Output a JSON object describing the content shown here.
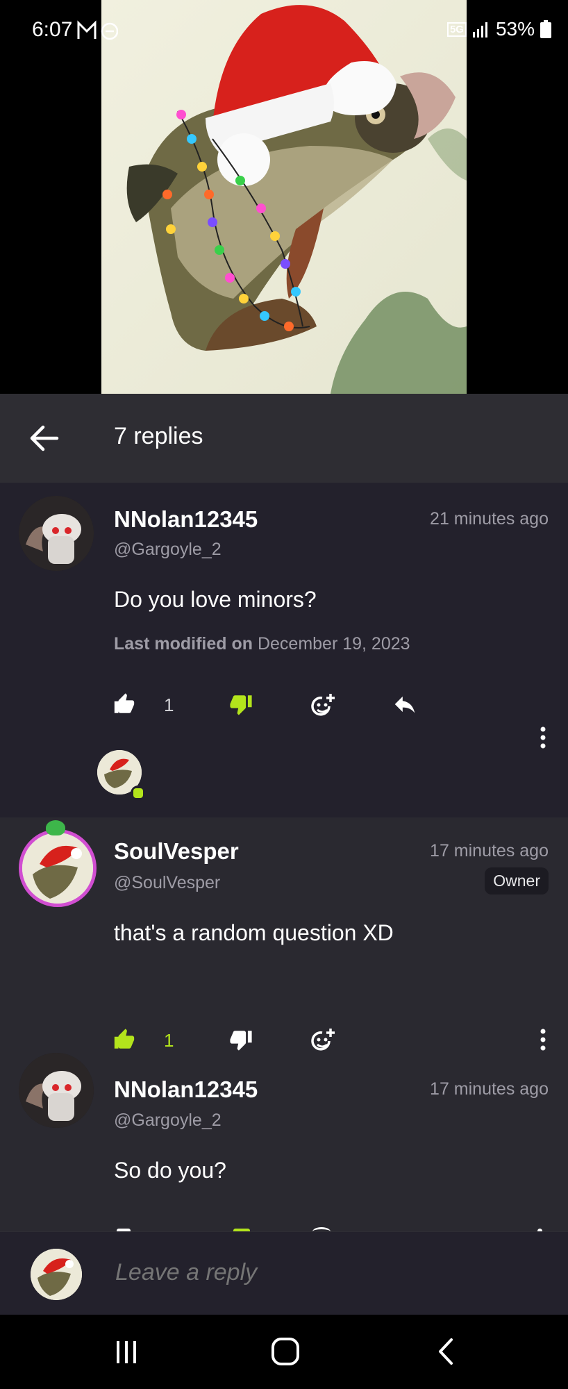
{
  "status_bar": {
    "time": "6:07",
    "battery": "53%",
    "icons": [
      "gmail-icon",
      "dnd-icon",
      "5g-icon",
      "signal-icon",
      "battery-icon"
    ]
  },
  "header": {
    "title": "7 replies",
    "back_icon": "arrow-left-icon"
  },
  "comments": [
    {
      "display_name": "NNolan12345",
      "handle": "@Gargoyle_2",
      "time": "21 minutes ago",
      "text": "Do you love minors?",
      "modified_label": "Last modified on",
      "modified_date": "December 19, 2023",
      "likes": "1"
    },
    {
      "display_name": "SoulVesper",
      "handle": "@SoulVesper",
      "time": "17 minutes ago",
      "badge": "Owner",
      "text": "that's a random question XD",
      "likes": "1"
    },
    {
      "display_name": "NNolan12345",
      "handle": "@Gargoyle_2",
      "time": "17 minutes ago",
      "text": "So do you?"
    }
  ],
  "reply_bar": {
    "placeholder": "Leave a reply"
  },
  "colors": {
    "accent_green": "#b3e41c",
    "owner_ring": "#d14ed1",
    "header_bg": "#2e2d33",
    "list_bg": "#23212c"
  }
}
